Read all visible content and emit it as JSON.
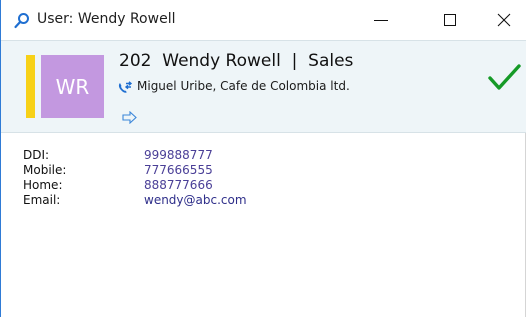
{
  "window": {
    "title": "User: Wendy Rowell",
    "icons": {
      "search": "search-icon",
      "minimize": "minimize-icon",
      "maximize": "maximize-icon",
      "close": "close-icon"
    }
  },
  "header": {
    "avatar_initials": "WR",
    "avatar_color": "#c398e0",
    "status_color": "#f7d117",
    "name_line": "202  Wendy Rowell  |  Sales",
    "connection_text": "Miguel Uribe, Cafe de Colombia ltd.",
    "icons": {
      "connection": "call-transfer-icon",
      "forward": "forward-arrow-icon",
      "status": "checkmark-icon"
    },
    "accent_check_color": "#159a27"
  },
  "details": [
    {
      "label": "DDI:",
      "value": "999888777"
    },
    {
      "label": "Mobile:",
      "value": "777666555"
    },
    {
      "label": "Home:",
      "value": "888777666"
    },
    {
      "label": "Email:",
      "value": "wendy@abc.com"
    }
  ]
}
